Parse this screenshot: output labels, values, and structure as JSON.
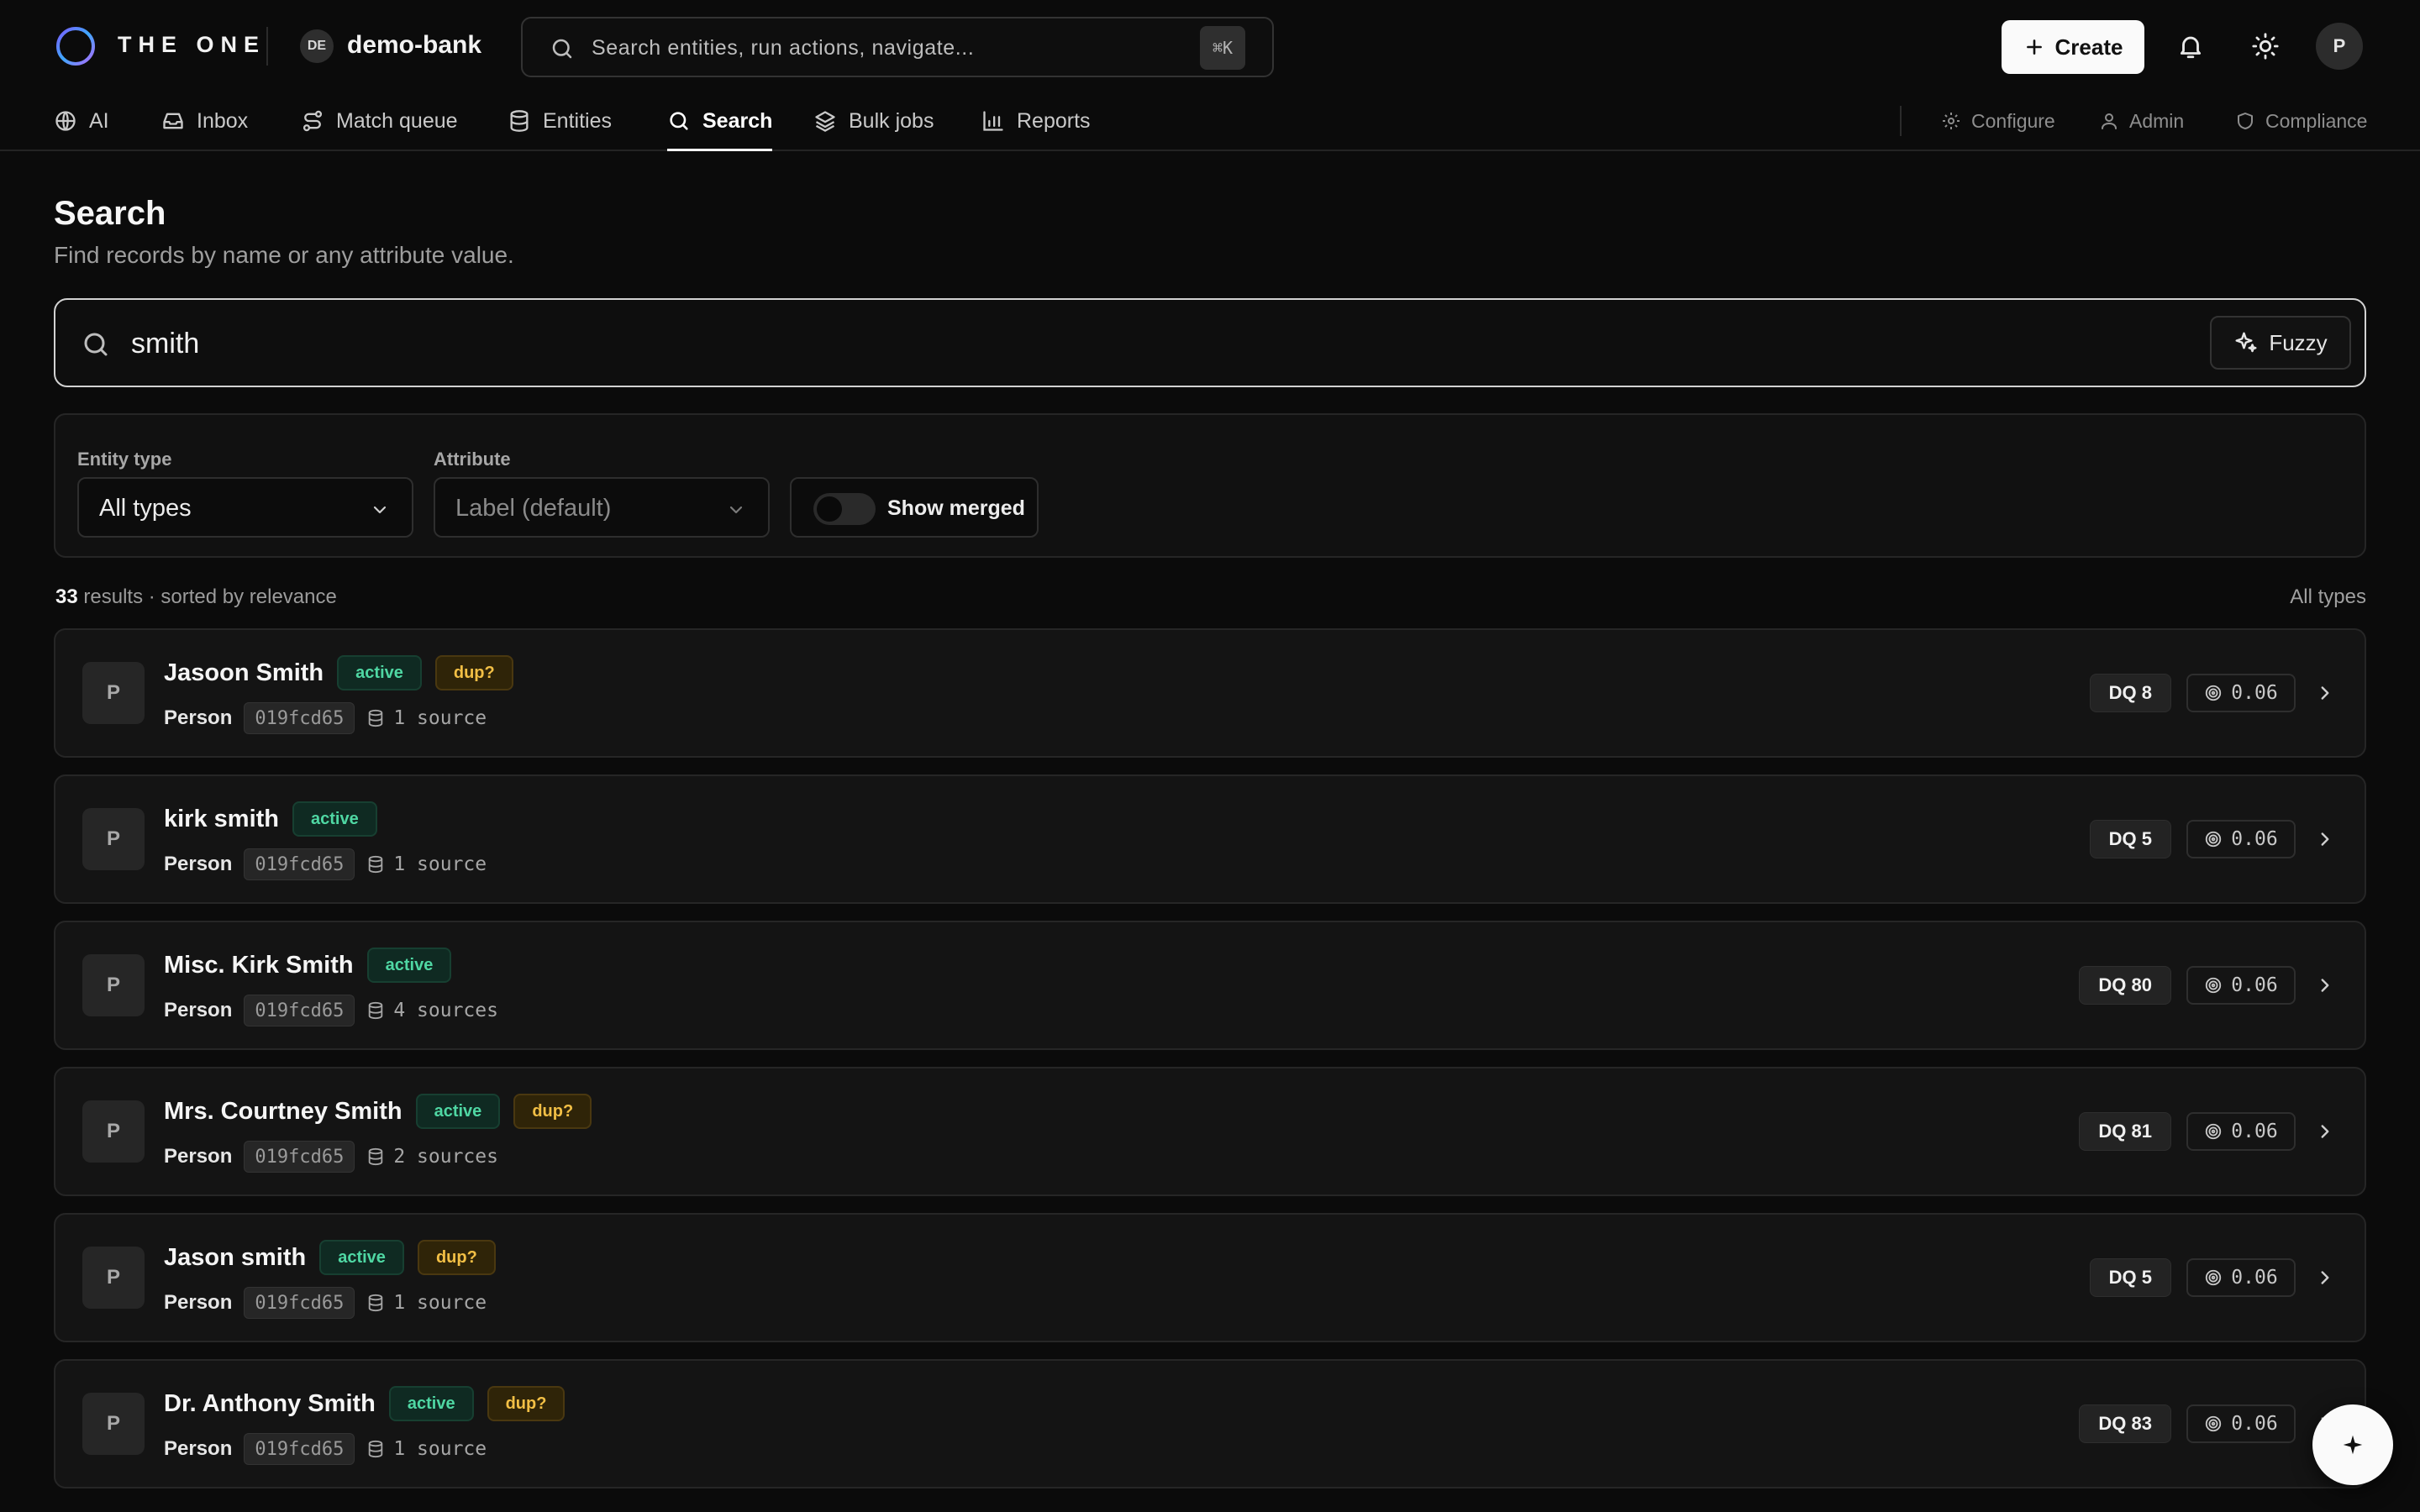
{
  "app": {
    "brand": "THE ONE",
    "workspace_initials": "DE",
    "workspace_name": "demo-bank",
    "command_placeholder": "Search entities, run actions, navigate...",
    "command_shortcut": "⌘K",
    "create_label": "Create",
    "user_initial": "P"
  },
  "nav": {
    "items": [
      {
        "label": "AI",
        "icon": "globe-icon"
      },
      {
        "label": "Inbox",
        "icon": "inbox-icon"
      },
      {
        "label": "Match queue",
        "icon": "route-icon"
      },
      {
        "label": "Entities",
        "icon": "database-icon"
      },
      {
        "label": "Search",
        "icon": "search-icon",
        "active": true
      },
      {
        "label": "Bulk jobs",
        "icon": "layers-icon"
      },
      {
        "label": "Reports",
        "icon": "bar-chart-icon"
      }
    ],
    "secondary": [
      {
        "label": "Configure",
        "icon": "gear-icon"
      },
      {
        "label": "Admin",
        "icon": "users-icon"
      },
      {
        "label": "Compliance",
        "icon": "shield-icon"
      }
    ]
  },
  "page": {
    "title": "Search",
    "subtitle": "Find records by name or any attribute value."
  },
  "search": {
    "value": "smith",
    "fuzzy_label": "Fuzzy"
  },
  "filters": {
    "entity_type_label": "Entity type",
    "entity_type_value": "All types",
    "attribute_label": "Attribute",
    "attribute_value": "Label (default)",
    "show_merged_label": "Show merged",
    "show_merged_on": false
  },
  "summary": {
    "count": "33",
    "text": "results · sorted by relevance",
    "right": "All types"
  },
  "results": [
    {
      "initial": "P",
      "name": "Jasoon Smith",
      "status": "active",
      "dup": "dup?",
      "type": "Person",
      "id": "019fcd65",
      "sources": "1 source",
      "dq": "DQ 8",
      "score": "0.06"
    },
    {
      "initial": "P",
      "name": "kirk smith",
      "status": "active",
      "dup": "",
      "type": "Person",
      "id": "019fcd65",
      "sources": "1 source",
      "dq": "DQ 5",
      "score": "0.06"
    },
    {
      "initial": "P",
      "name": "Misc. Kirk Smith",
      "status": "active",
      "dup": "",
      "type": "Person",
      "id": "019fcd65",
      "sources": "4 sources",
      "dq": "DQ 80",
      "score": "0.06"
    },
    {
      "initial": "P",
      "name": "Mrs. Courtney Smith",
      "status": "active",
      "dup": "dup?",
      "type": "Person",
      "id": "019fcd65",
      "sources": "2 sources",
      "dq": "DQ 81",
      "score": "0.06"
    },
    {
      "initial": "P",
      "name": "Jason smith",
      "status": "active",
      "dup": "dup?",
      "type": "Person",
      "id": "019fcd65",
      "sources": "1 source",
      "dq": "DQ 5",
      "score": "0.06"
    },
    {
      "initial": "P",
      "name": "Dr. Anthony Smith",
      "status": "active",
      "dup": "dup?",
      "type": "Person",
      "id": "019fcd65",
      "sources": "1 source",
      "dq": "DQ 83",
      "score": "0.06"
    }
  ],
  "fab_icon": "sparkle-icon",
  "colors": {
    "background": "#0b0b0b",
    "active_badge": "#4fd7a3",
    "dup_badge": "#f2bf45",
    "primary_button": "#fafafa"
  }
}
